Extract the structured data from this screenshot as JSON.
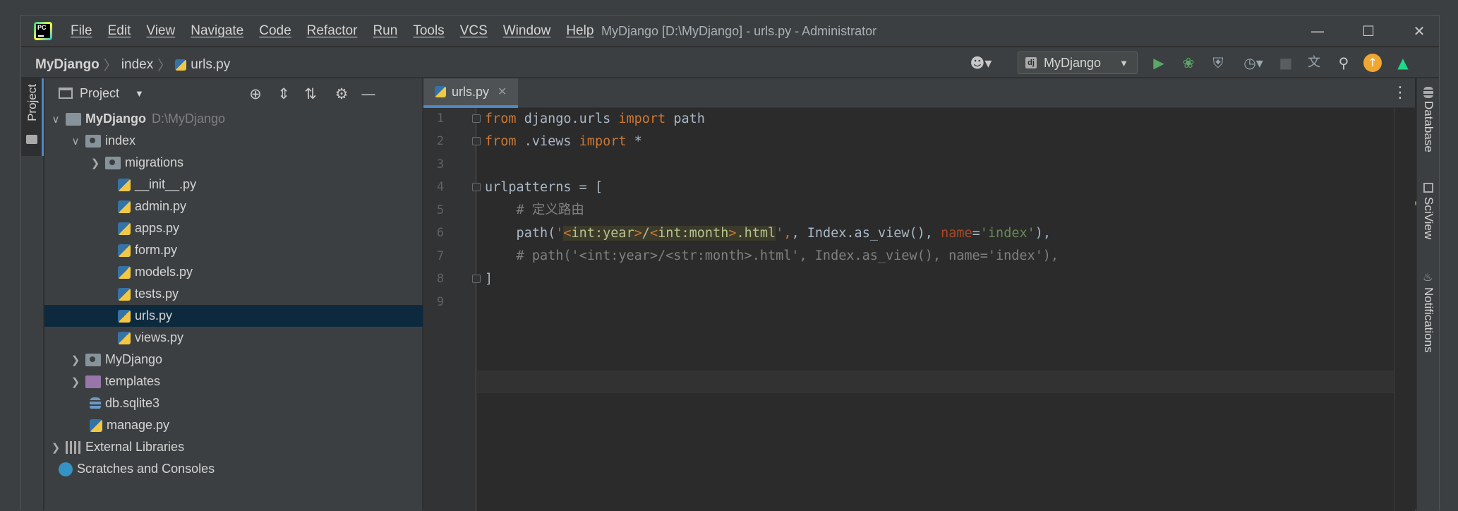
{
  "titlebar": {
    "menu": [
      "File",
      "Edit",
      "View",
      "Navigate",
      "Code",
      "Refactor",
      "Run",
      "Tools",
      "VCS",
      "Window",
      "Help"
    ],
    "window_title": "MyDjango [D:\\MyDjango] - urls.py - Administrator",
    "logo": "PC"
  },
  "navbar": {
    "breadcrumbs": [
      "MyDjango",
      "index",
      "urls.py"
    ],
    "run_config": "MyDjango",
    "run_config_icon": "dj"
  },
  "left_stripe": {
    "project_tab": "Project"
  },
  "project_panel": {
    "title": "Project",
    "tree": [
      {
        "label": "MyDjango",
        "hint": "D:\\MyDjango"
      },
      {
        "label": "index"
      },
      {
        "label": "migrations"
      },
      {
        "label": "__init__.py"
      },
      {
        "label": "admin.py"
      },
      {
        "label": "apps.py"
      },
      {
        "label": "form.py"
      },
      {
        "label": "models.py"
      },
      {
        "label": "tests.py"
      },
      {
        "label": "urls.py"
      },
      {
        "label": "views.py"
      },
      {
        "label": "MyDjango"
      },
      {
        "label": "templates"
      },
      {
        "label": "db.sqlite3"
      },
      {
        "label": "manage.py"
      },
      {
        "label": "External Libraries"
      },
      {
        "label": "Scratches and Consoles"
      }
    ]
  },
  "editor": {
    "active_tab": "urls.py",
    "line_numbers": [
      "1",
      "2",
      "3",
      "4",
      "5",
      "6",
      "7",
      "8",
      "9"
    ],
    "code": {
      "l1": {
        "kw1": "from",
        "mid": " django.urls ",
        "kw2": "import",
        "rest": " path"
      },
      "l2": {
        "kw1": "from",
        "mid": " .views ",
        "kw2": "import",
        "rest": " *"
      },
      "l4": "urlpatterns = [",
      "l5": "    # 定义路由",
      "l6": {
        "pre": "    path(",
        "q1": "'",
        "t1": "<",
        "h1": "int",
        "c1": ":year",
        "t2": ">",
        "sl": "/",
        "t3": "<",
        "h2": "int",
        "c2": ":month",
        "t4": ">",
        "ext": ".html",
        "q2": "'",
        "mid": ", Index.as_view(), ",
        "kwarg": "name",
        "eq": "=",
        "val": "'index'",
        "end": "),"
      },
      "l7": "    # path('<int:year>/<str:month>.html', Index.as_view(), name='index'),",
      "l8": "]"
    }
  },
  "right_stripe": {
    "tabs": [
      "Database",
      "SciView",
      "Notifications"
    ]
  }
}
